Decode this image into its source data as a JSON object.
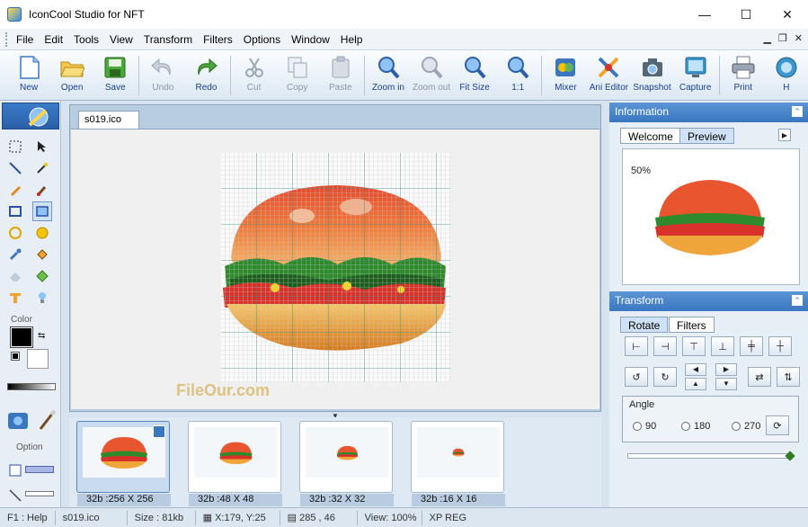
{
  "window": {
    "title": "IconCool Studio for NFT",
    "controls": [
      "—",
      "☐",
      "✕"
    ]
  },
  "menu": [
    "File",
    "Edit",
    "Tools",
    "View",
    "Transform",
    "Filters",
    "Options",
    "Window",
    "Help"
  ],
  "toolbar": [
    {
      "label": "New",
      "enabled": true
    },
    {
      "label": "Open",
      "enabled": true
    },
    {
      "label": "Save",
      "enabled": true
    },
    {
      "label": "Undo",
      "enabled": false
    },
    {
      "label": "Redo",
      "enabled": true
    },
    {
      "label": "Cut",
      "enabled": false
    },
    {
      "label": "Copy",
      "enabled": false
    },
    {
      "label": "Paste",
      "enabled": false
    },
    {
      "label": "Zoom in",
      "enabled": true
    },
    {
      "label": "Zoom out",
      "enabled": false
    },
    {
      "label": "Fit Size",
      "enabled": true
    },
    {
      "label": "1:1",
      "enabled": true
    },
    {
      "label": "Mixer",
      "enabled": true
    },
    {
      "label": "Ani Editor",
      "enabled": true
    },
    {
      "label": "Snapshot",
      "enabled": true
    },
    {
      "label": "Capture",
      "enabled": true
    },
    {
      "label": "Print",
      "enabled": true
    },
    {
      "label": "H",
      "enabled": true
    }
  ],
  "left_panel": {
    "color_label": "Color",
    "option_label": "Option"
  },
  "document": {
    "tab": "s019.ico",
    "watermark": "FileOur.com"
  },
  "thumbnails": [
    {
      "caption": "32b :256 X 256",
      "scale": 1.0,
      "selected": true
    },
    {
      "caption": "32b :48 X 48",
      "scale": 0.7,
      "selected": false
    },
    {
      "caption": "32b :32 X 32",
      "scale": 0.45,
      "selected": false
    },
    {
      "caption": "32b :16 X 16",
      "scale": 0.25,
      "selected": false
    }
  ],
  "information": {
    "title": "Information",
    "tabs": [
      "Welcome",
      "Preview"
    ],
    "active_tab": "Preview",
    "zoom": "50%"
  },
  "transform": {
    "title": "Transform",
    "tabs": [
      "Rotate",
      "Filters"
    ],
    "active_tab": "Rotate",
    "angle_label": "Angle",
    "angles": [
      "90",
      "180",
      "270"
    ]
  },
  "status": {
    "help": "F1 : Help",
    "file": "s019.ico",
    "size": "Size : 81kb",
    "coords": "X:179, Y:25",
    "dims": "285 , 46",
    "view": "View: 100%",
    "mode": "XP REG"
  }
}
